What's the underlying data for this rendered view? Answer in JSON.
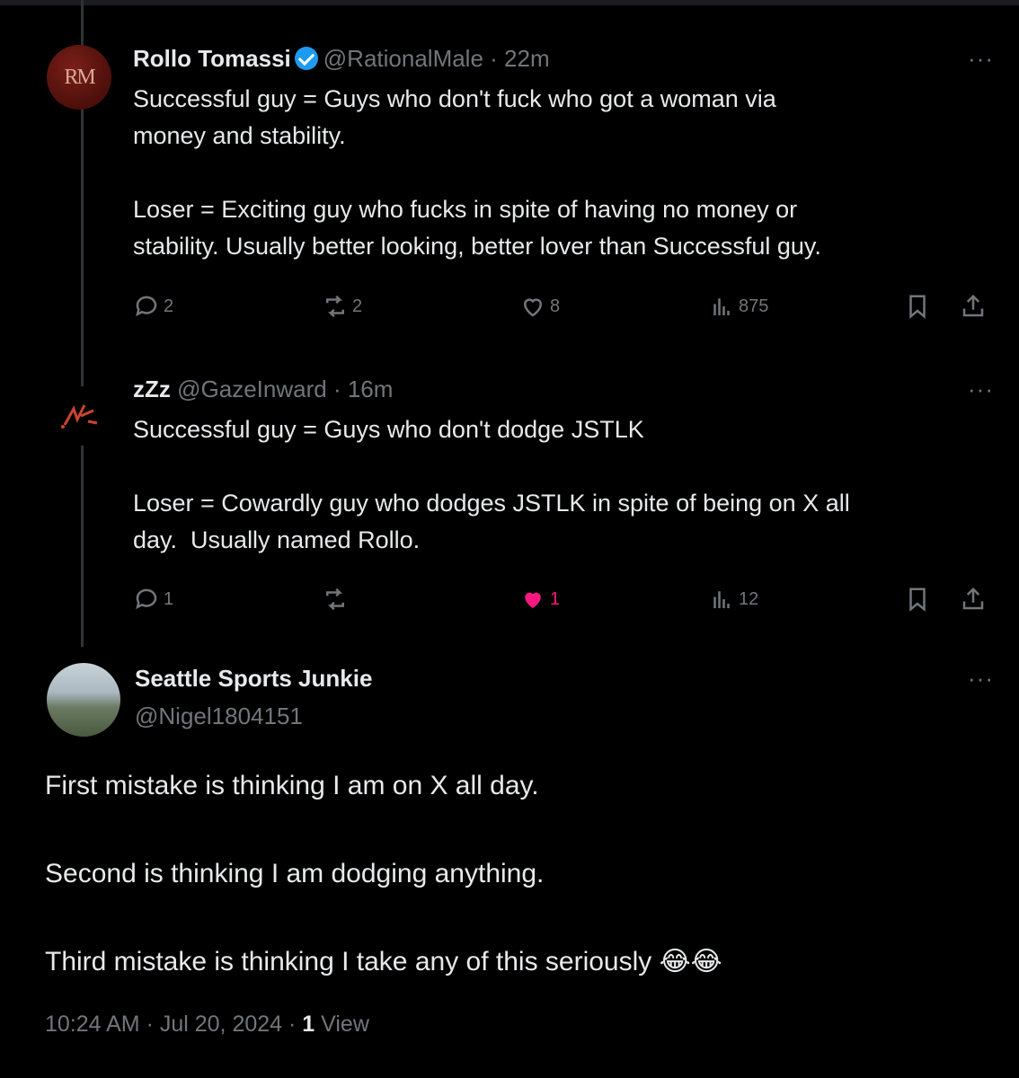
{
  "tweets": [
    {
      "name": "Rollo Tomassi",
      "handle": "@RationalMale",
      "time": "· 22m",
      "avatar_text": "RM",
      "text": "Successful guy = Guys who don't fuck who got a woman via\nmoney and stability.\n\nLoser = Exciting guy who fucks in spite of having no money or\nstability. Usually better looking, better lover than Successful guy.",
      "replies": "2",
      "reposts": "2",
      "likes": "8",
      "views": "875",
      "liked": false
    },
    {
      "name": "zZz",
      "handle": "@GazeInward",
      "time": "· 16m",
      "text": "Successful guy = Guys who don't dodge JSTLK\n\nLoser = Cowardly guy who dodges JSTLK in spite of being on X all\nday.  Usually named Rollo.",
      "replies": "1",
      "reposts": "",
      "likes": "1",
      "views": "12",
      "liked": true
    }
  ],
  "main": {
    "name": "Seattle Sports Junkie",
    "handle": "@Nigel1804151",
    "text": "First mistake is thinking I am on X all day.\n\nSecond is thinking I am dodging anything.\n\nThird mistake is thinking I take any of this seriously 😂😂",
    "time": "10:24 AM · Jul 20, 2024 · ",
    "views_count": "1",
    "views_label": " View"
  },
  "ui": {
    "more": "···"
  },
  "icons": [
    "verified-badge-icon",
    "reply-icon",
    "repost-icon",
    "like-icon",
    "views-icon",
    "bookmark-icon",
    "share-icon"
  ],
  "colors": {
    "background": "#000000",
    "muted": "#71767b",
    "like": "#f91880",
    "verified": "#1d9bf0"
  }
}
